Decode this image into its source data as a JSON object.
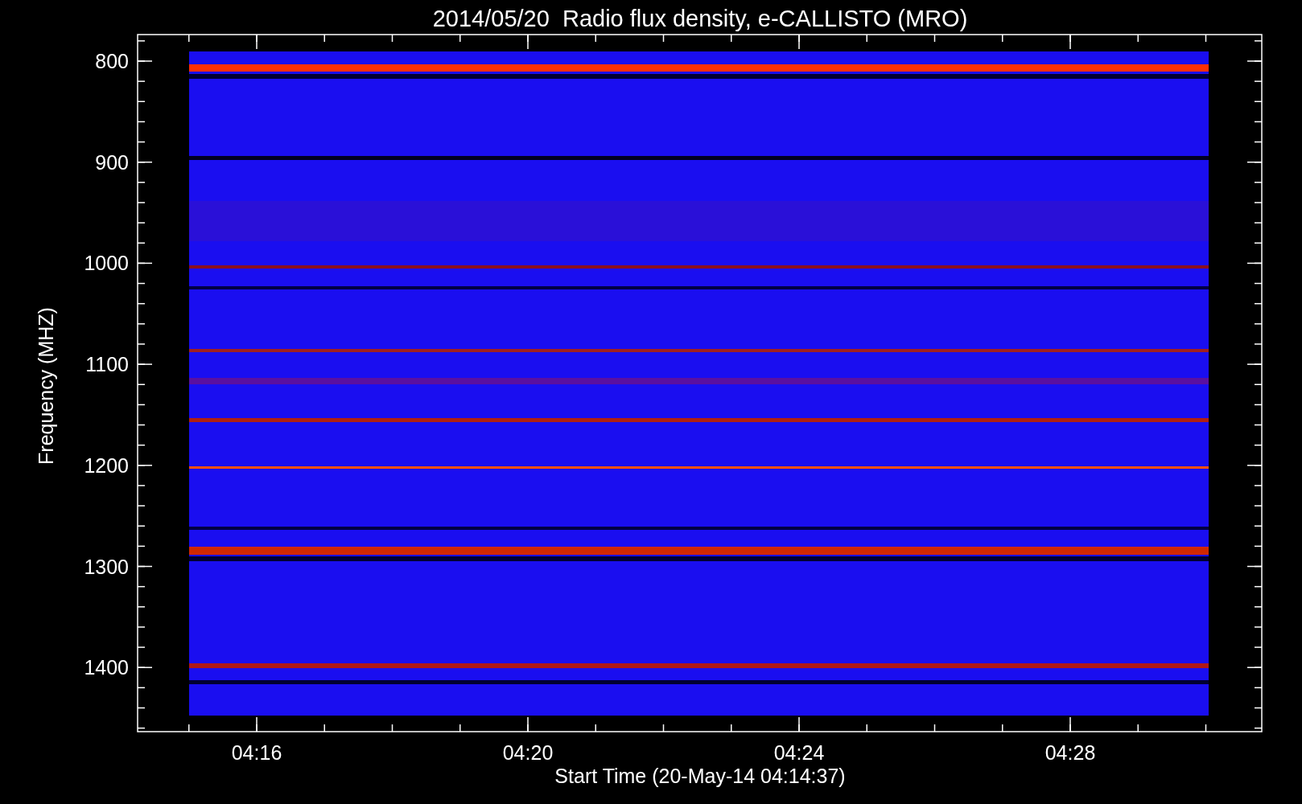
{
  "title": "2014/05/20  Radio flux density, e-CALLISTO (MRO)",
  "y_axis": {
    "label": "Frequency (MHZ)",
    "ticks": [
      "800",
      "900",
      "1000",
      "1100",
      "1200",
      "1300",
      "1400"
    ]
  },
  "x_axis": {
    "label": "Start Time (20-May-14 04:14:37)",
    "ticks": [
      "04:16",
      "04:20",
      "04:24",
      "04:28"
    ]
  }
}
